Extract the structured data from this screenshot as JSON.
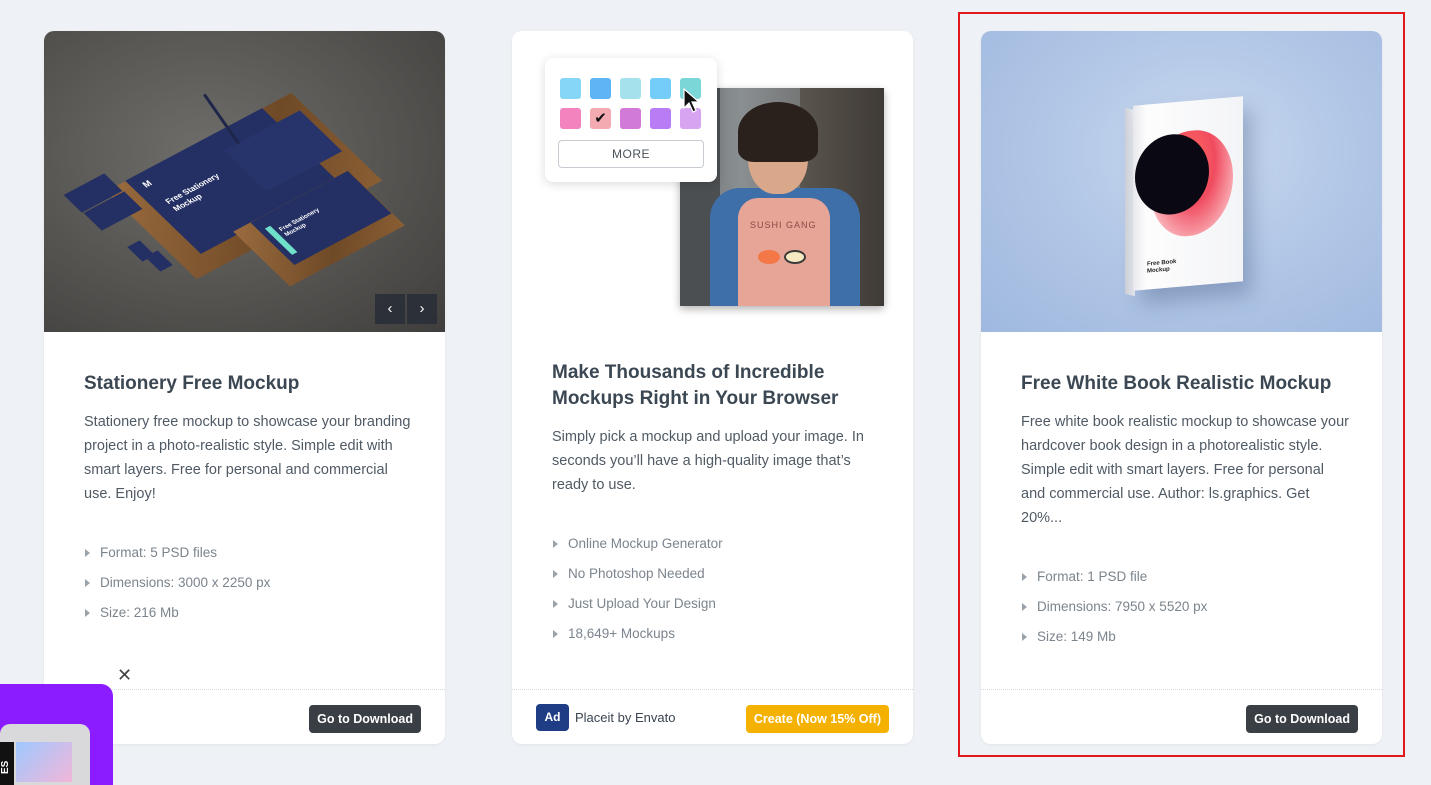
{
  "cards": [
    {
      "title": "Stationery Free Mockup",
      "description": "Stationery free mockup to showcase your branding project in a photo-realistic style. Simple edit with smart layers. Free for personal and commercial use. Enjoy!",
      "specs": [
        "Format: 5 PSD files",
        "Dimensions: 3000 x 2250 px",
        "Size: 216 Mb"
      ],
      "image_text": {
        "sheet": "Free Stationery Mockup",
        "card": "Free Stationery Mockup",
        "logo": "M"
      },
      "prev_icon": "‹",
      "next_icon": "›",
      "button": "Go to Download"
    },
    {
      "title": "Make Thousands of Incredible Mockups Right in Your Browser",
      "description": "Simply pick a mockup and upload your image. In seconds you’ll have a high-quality image that’s ready to use.",
      "specs": [
        "Online Mockup Generator",
        "No Photoshop Needed",
        "Just Upload Your Design",
        "18,649+ Mockups"
      ],
      "more_label": "MORE",
      "checkmark": "✔",
      "shirt_text": "SUSHI GANG",
      "ad_badge": "Ad",
      "ad_text": "Placeit by Envato",
      "button": "Create (Now 15% Off)"
    },
    {
      "title": "Free White Book Realistic Mockup",
      "description": "Free white book realistic mockup to showcase your hardcover book design in a photorealistic style. Simple edit with smart layers. Free for personal and commercial use. Author: ls.graphics. Get 20%...",
      "specs": [
        "Format: 1 PSD file",
        "Dimensions: 7950 x 5520 px",
        "Size: 149 Mb"
      ],
      "book_label": "Free Book Mockup",
      "button": "Go to Download"
    }
  ],
  "swatches": [
    "#86d6f7",
    "#5fb4f5",
    "#a4e1ec",
    "#74cdf8",
    "#7bd6d8",
    "#f283bf",
    "#f3aab1",
    "#d17ad8",
    "#b97cf5",
    "#d7a4f1"
  ],
  "promo": {
    "tag": "ES",
    "close": "✕"
  },
  "colors": {
    "highlight": "#e01a1a",
    "create_button": "#f5b100",
    "download_button": "#3a3f45",
    "ad_badge": "#1e3d85"
  }
}
